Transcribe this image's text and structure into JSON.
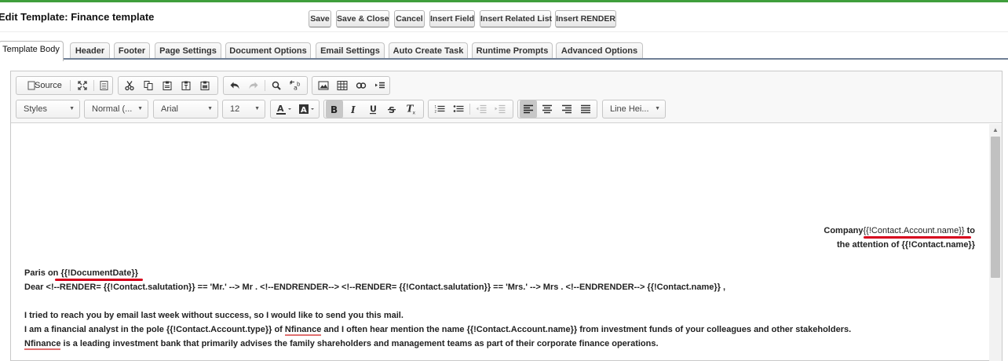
{
  "header": {
    "title": "Edit Template: Finance template",
    "buttons": [
      "Save",
      "Save & Close",
      "Cancel",
      "Insert Field",
      "Insert Related List",
      "Insert RENDER"
    ]
  },
  "tabs": [
    "Template Body",
    "Header",
    "Footer",
    "Page Settings",
    "Document Options",
    "Email Settings",
    "Auto Create Task",
    "Runtime Prompts",
    "Advanced Options"
  ],
  "active_tab": "Template Body",
  "toolbar": {
    "source_label": "Source",
    "styles": "Styles",
    "format": "Normal (...",
    "font": "Arial",
    "size": "12",
    "line_height": "Line Hei..."
  },
  "body": {
    "company_prefix": "Company",
    "company_field": "{{!Contact.Account.name}}",
    "company_suffix": " to",
    "attention": "the attention of {{!Contact.name}}",
    "paris_prefix": "Paris on ",
    "document_date": "{{!DocumentDate}}",
    "dear": "Dear  <!--RENDER= {{!Contact.salutation}} == 'Mr.' --> Mr . <!--ENDRENDER--> <!--RENDER= {{!Contact.salutation}} == 'Mrs.' --> Mrs . <!--ENDRENDER--> {{!Contact.name}} ,",
    "p1": "I tried to reach you by email last week without success, so I would like to send you this mail.",
    "p2_a": "I am a financial analyst in the pole {{!Contact.Account.type}} of ",
    "p2_nfinance": "Nfinance",
    "p2_b": " and I often hear mention the name {{!Contact.Account.name}} from investment funds of your colleagues and other stakeholders.",
    "p3_nfinance": "Nfinance",
    "p3_b": " is a leading investment bank that primarily advises the family shareholders and management teams as part of their corporate finance operations."
  }
}
